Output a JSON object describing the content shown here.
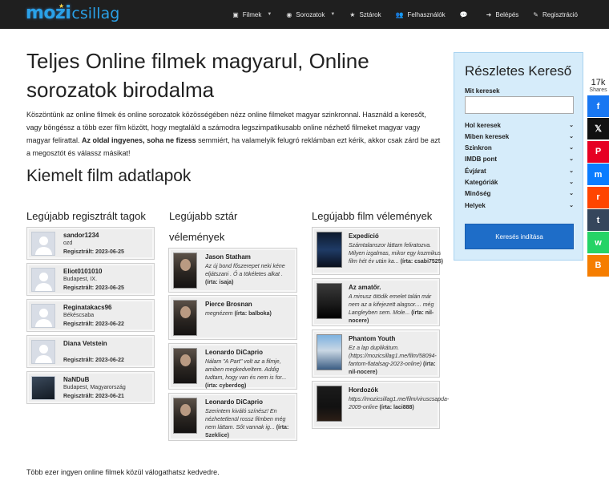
{
  "nav": {
    "logo_part1": "mozi",
    "logo_part2": "csillag",
    "items": [
      {
        "label": "Filmek",
        "icon": "film-icon",
        "dropdown": true
      },
      {
        "label": "Sorozatok",
        "icon": "series-icon",
        "dropdown": true
      },
      {
        "label": "Sztárok",
        "icon": "star-icon",
        "dropdown": false
      },
      {
        "label": "Felhasználók",
        "icon": "users-icon",
        "dropdown": false
      },
      {
        "label": "",
        "icon": "comment-icon",
        "dropdown": false
      },
      {
        "label": "Belépés",
        "icon": "login-icon",
        "dropdown": false
      },
      {
        "label": "Regisztráció",
        "icon": "edit-icon",
        "dropdown": false
      }
    ]
  },
  "main": {
    "title": "Teljes Online filmek magyarul, Online sorozatok birodalma",
    "intro_part1": "Köszöntünk az online filmek és online sorozatok közösségében nézz online filmeket magyar szinkronnal. Használd a keresőt, vagy böngéssz a több ezer film között, hogy megtaláld a számodra legszimpatikusabb online nézhető filmeket magyar vagy magyar felirattal.",
    "intro_bold": "Az oldal ingyenes, soha ne fizess",
    "intro_part2": "semmiért, ha valamelyik felugró reklámban ezt kérik, akkor csak zárd be azt a megosztót és válassz másikat!",
    "featured_title": "Kiemelt film adatlapok",
    "footer": "Több ezer ingyen online filmek közül válogathatsz kedvedre."
  },
  "users": {
    "title": "Legújabb regisztrált tagok",
    "items": [
      {
        "name": "sandor1234",
        "location": "ozd",
        "registered": "Regisztrált: 2023-06-25"
      },
      {
        "name": "Eliot0101010",
        "location": "Budapest, IX.",
        "registered": "Regisztrált: 2023-06-25"
      },
      {
        "name": "Reginatakacs96",
        "location": "Békéscsaba",
        "registered": "Regisztrált: 2023-06-22"
      },
      {
        "name": "Diana Vetstein",
        "location": "",
        "registered": "Regisztrált: 2023-06-22"
      },
      {
        "name": "NaNDuB",
        "location": "Budapest, Magyarország",
        "registered": "Regisztrált: 2023-06-21"
      }
    ]
  },
  "stars": {
    "title": "Legújabb sztár vélemények",
    "items": [
      {
        "name": "Jason Statham",
        "text": "Az új bond főszerepet neki kéne eljátszani . Ő a tökéletes alkat .",
        "by": "(írta: isaja)"
      },
      {
        "name": "Pierce Brosnan",
        "text": "megnézem",
        "by": "(írta: balboka)"
      },
      {
        "name": "Leonardo DiCaprio",
        "text": "Nálam \"A Part\" volt az a filmje, amiben megkedveltem. Addig tudtam, hogy van és nem is for...",
        "by": "(írta: cyberdog)"
      },
      {
        "name": "Leonardo DiCaprio",
        "text": "Szerintem kiváló színész! En nézhetetlenül rossz filmben még nem láttam. Sőt vannak ig...",
        "by": "(írta: Szeklice)"
      }
    ]
  },
  "films": {
    "title": "Legújabb film vélemények",
    "items": [
      {
        "name": "Expedíció",
        "text": "Számtalanszor láttam feliratozva. Milyen izgalmas, mikor egy kozmikus film hét év után ka...",
        "by": "(írta: csabi7525)"
      },
      {
        "name": "Az amatőr.",
        "text": "A minusz ötödik emelet talán már nem az a kifejezett alagsor.... még Langleyben sem. Mole...",
        "by": "(írta: nil-nocere)"
      },
      {
        "name": "Phantom Youth",
        "text": "Ez a lap duplikátum. (https://mozicsillag1.me/film/58094-fantom-fiatalsag-2023-online)",
        "by": "(írta: nil-nocere)"
      },
      {
        "name": "Hordozók",
        "text": "https://mozicsillag1.me/film/viruscsapda-2009-online",
        "by": "(írta: laci888)"
      }
    ]
  },
  "search": {
    "title": "Részletes Kereső",
    "label": "Mit keresek",
    "input_value": "",
    "filters": [
      "Hol keresek",
      "Miben keresek",
      "Szinkron",
      "IMDB pont",
      "Évjárat",
      "Kategóriák",
      "Minőség",
      "Helyek"
    ],
    "button": "Keresés indítása"
  },
  "share": {
    "count": "17k",
    "label": "Shares",
    "buttons": [
      {
        "name": "facebook-icon",
        "glyph": "f",
        "color": "#1877f2"
      },
      {
        "name": "x-twitter-icon",
        "glyph": "𝕏",
        "color": "#111111"
      },
      {
        "name": "pinterest-icon",
        "glyph": "P",
        "color": "#e60023"
      },
      {
        "name": "messenger-icon",
        "glyph": "m",
        "color": "#0a7cff"
      },
      {
        "name": "reddit-icon",
        "glyph": "r",
        "color": "#ff4500"
      },
      {
        "name": "tumblr-icon",
        "glyph": "t",
        "color": "#35465c"
      },
      {
        "name": "whatsapp-icon",
        "glyph": "w",
        "color": "#25d366"
      },
      {
        "name": "blogger-icon",
        "glyph": "B",
        "color": "#f57d00"
      }
    ]
  }
}
